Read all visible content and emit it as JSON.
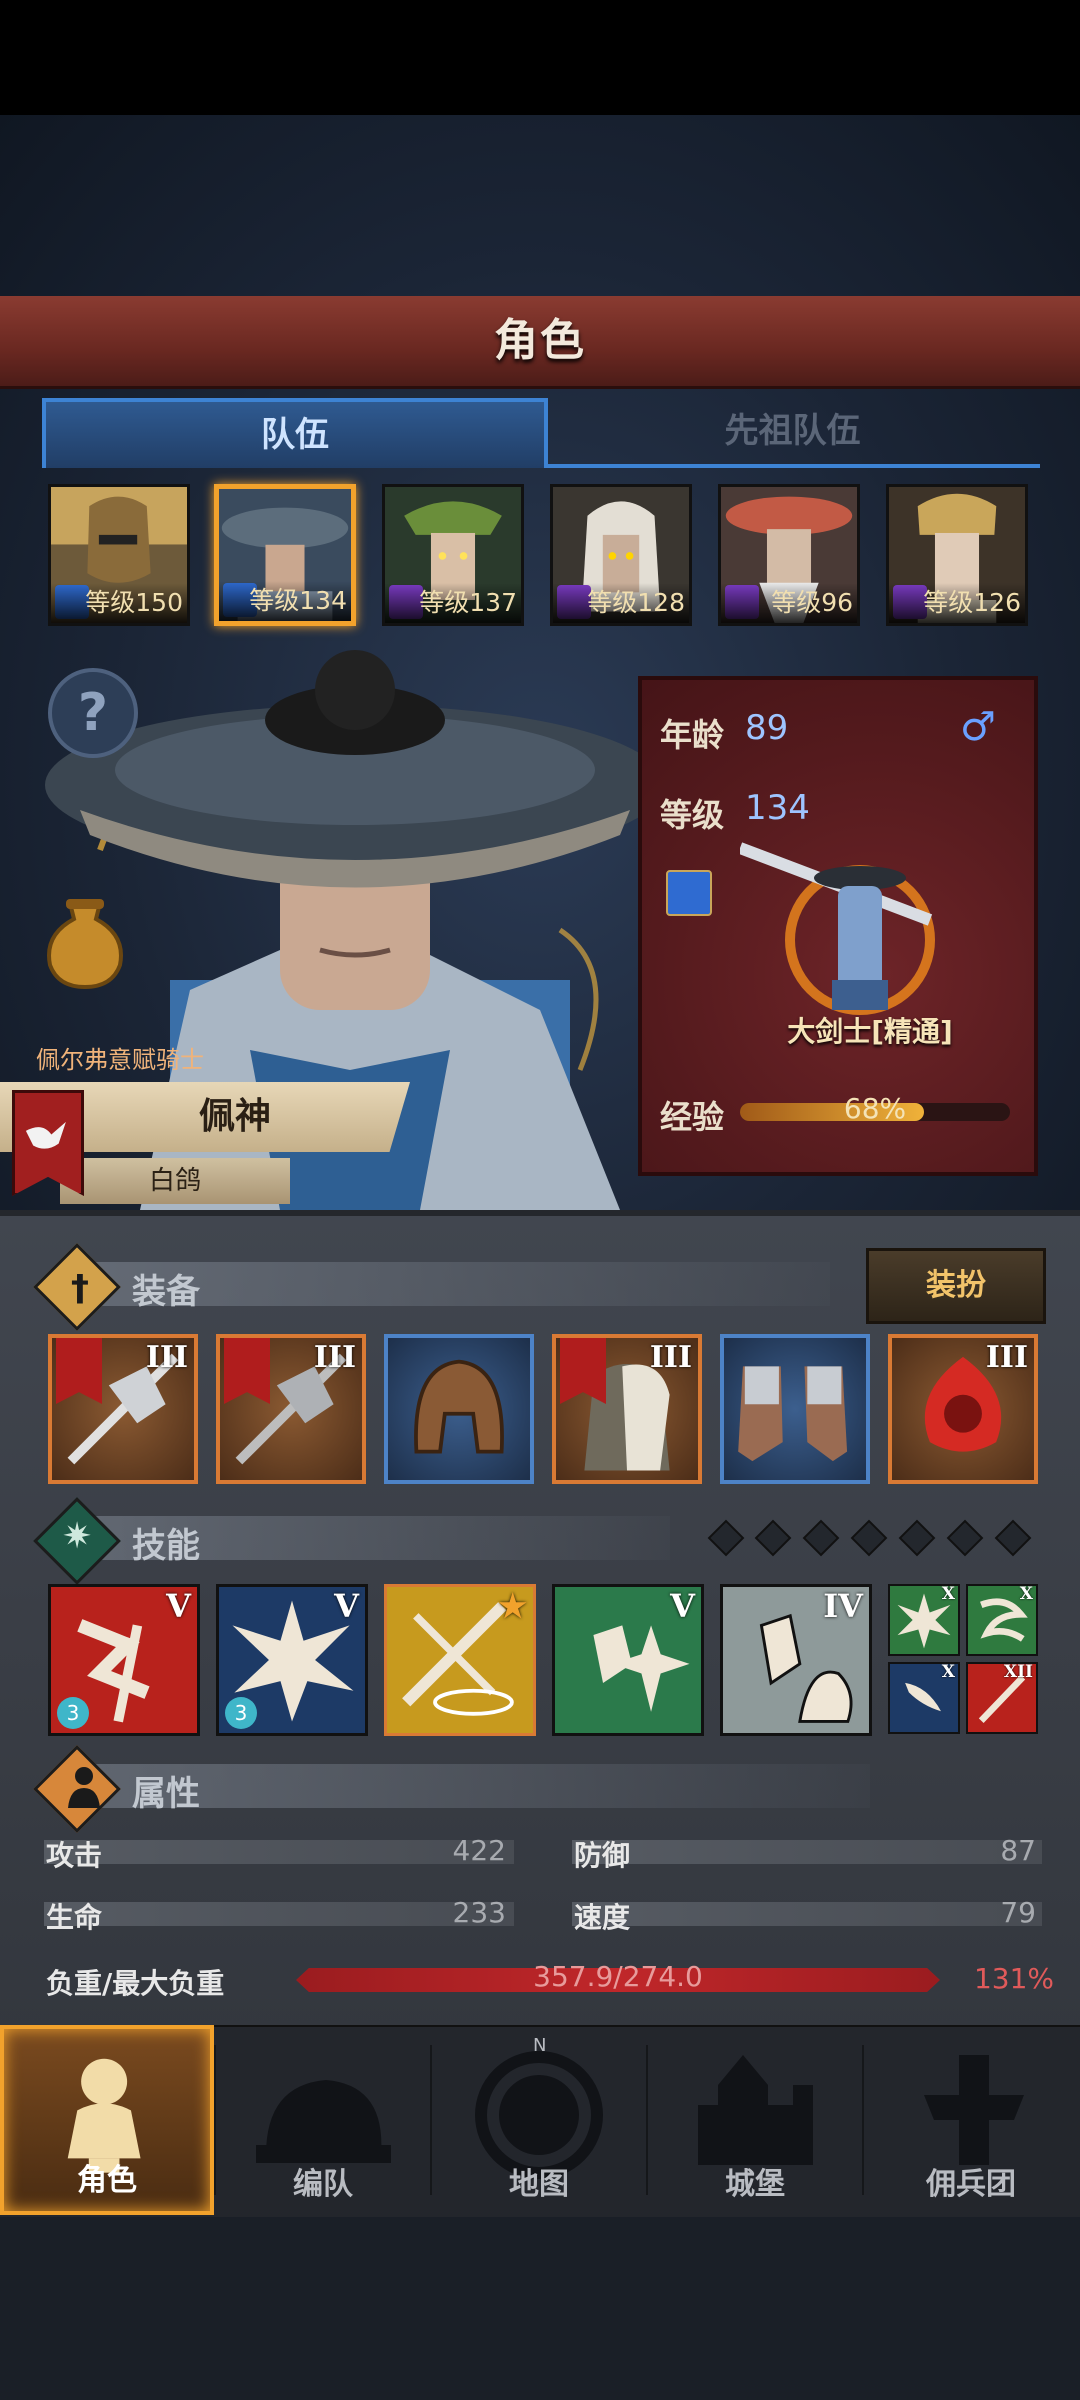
{
  "header": {
    "title": "角色"
  },
  "tabs": [
    {
      "label": "队伍",
      "active": true
    },
    {
      "label": "先祖队伍",
      "active": false
    }
  ],
  "portraits": [
    {
      "level": "等级150",
      "selected": false,
      "class_color": "#2f6bd1"
    },
    {
      "level": "等级134",
      "selected": true,
      "class_color": "#2f6bd1"
    },
    {
      "level": "等级137",
      "selected": false,
      "class_color": "#7a3bc2"
    },
    {
      "level": "等级128",
      "selected": false,
      "class_color": "#7a3bc2"
    },
    {
      "level": "等级96",
      "selected": false,
      "class_color": "#7a3bc2"
    },
    {
      "level": "等级126",
      "selected": false,
      "class_color": "#7a3bc2"
    }
  ],
  "hero": {
    "order": "佩尔弗意赋骑士",
    "name": "佩神",
    "subtitle": "白鸽",
    "help_icon": "?"
  },
  "info": {
    "age_label": "年龄",
    "age": "89",
    "gender_icon": "♂",
    "level_label": "等级",
    "level": "134",
    "class_name": "大剑士[精通]",
    "exp_label": "经验",
    "exp_text": "68%",
    "exp_fraction": 0.68
  },
  "equipment": {
    "title": "装备",
    "outfit_button": "装扮",
    "slots": [
      {
        "name": "halberd",
        "tier": "III",
        "flag": true
      },
      {
        "name": "halberd",
        "tier": "III",
        "flag": true
      },
      {
        "name": "helmet",
        "tier": "",
        "flag": false
      },
      {
        "name": "armor",
        "tier": "III",
        "flag": true
      },
      {
        "name": "boots",
        "tier": "",
        "flag": false
      },
      {
        "name": "phoenix-emblem",
        "tier": "III",
        "flag": false
      }
    ]
  },
  "skills": {
    "title": "技能",
    "main": [
      {
        "name": "multi-slash",
        "tier": "V",
        "gem": "3"
      },
      {
        "name": "burst",
        "tier": "V",
        "gem": "3"
      },
      {
        "name": "sword-aura",
        "tier": "★",
        "gem": ""
      },
      {
        "name": "crystal-burst",
        "tier": "V",
        "gem": ""
      },
      {
        "name": "crystal-strike",
        "tier": "IV",
        "gem": ""
      }
    ],
    "mini": [
      {
        "name": "burst",
        "tier": "X"
      },
      {
        "name": "gust",
        "tier": "X"
      },
      {
        "name": "wing",
        "tier": "X"
      },
      {
        "name": "blade",
        "tier": "XII"
      }
    ]
  },
  "attributes": {
    "title": "属性",
    "attack_label": "攻击",
    "attack": "422",
    "defense_label": "防御",
    "defense": "87",
    "hp_label": "生命",
    "hp": "233",
    "speed_label": "速度",
    "speed": "79",
    "load_label": "负重/最大负重",
    "load_text": "357.9/274.0",
    "load_percent": "131%"
  },
  "nav": [
    {
      "label": "角色",
      "active": true
    },
    {
      "label": "编队",
      "active": false
    },
    {
      "label": "地图",
      "active": false
    },
    {
      "label": "城堡",
      "active": false
    },
    {
      "label": "佣兵团",
      "active": false
    }
  ],
  "colors": {
    "accent_gold": "#f2a22c",
    "tab_blue": "#3d83d4",
    "overload_red": "#c0272a",
    "title_red": "#7a2e27"
  }
}
